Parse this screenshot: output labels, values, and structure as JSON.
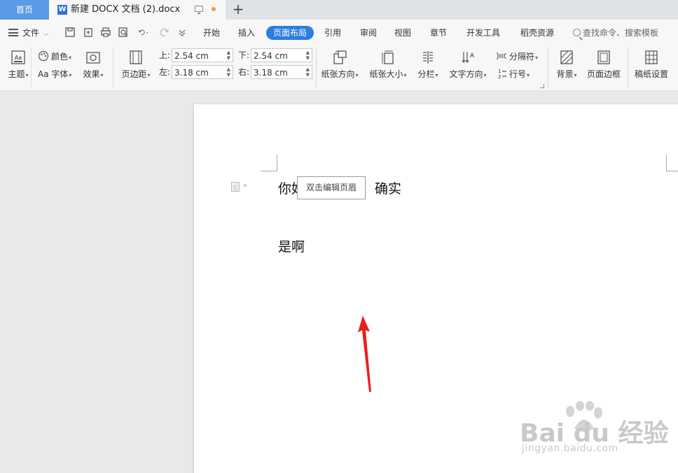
{
  "tabs": {
    "home": "首页",
    "document": "新建 DOCX 文档 (2).docx",
    "new_tab": "+"
  },
  "menu": {
    "file": "文件",
    "tabs": [
      "开始",
      "插入",
      "页面布局",
      "引用",
      "审阅",
      "视图",
      "章节",
      "开发工具",
      "稻壳资源"
    ],
    "active_tab": "页面布局",
    "search": "查找命令、搜索模板"
  },
  "ribbon": {
    "theme": "主题",
    "color": "颜色",
    "font": "Aa 字体",
    "effect": "效果",
    "margins": "页边距",
    "top_label": "上:",
    "top_value": "2.54 cm",
    "bottom_label": "下:",
    "bottom_value": "2.54 cm",
    "left_label": "左:",
    "left_value": "3.18 cm",
    "right_label": "右:",
    "right_value": "3.18 cm",
    "orientation": "纸张方向",
    "size": "纸张大小",
    "columns": "分栏",
    "text_direction": "文字方向",
    "breaks": "分隔符",
    "line_numbers": "行号",
    "background": "背景",
    "page_border": "页面边框",
    "manuscript": "稿纸设置"
  },
  "document": {
    "line1_before": "你好",
    "line1_after": "啊，确实",
    "line2": "是啊",
    "header_tooltip": "双击编辑页眉"
  },
  "watermark": {
    "brand": "Bai du 经验",
    "url": "jingyan.baidu.com"
  },
  "colors": {
    "accent": "#2b7de0",
    "home_tab": "#5a9be6",
    "arrow": "#e8201b"
  }
}
